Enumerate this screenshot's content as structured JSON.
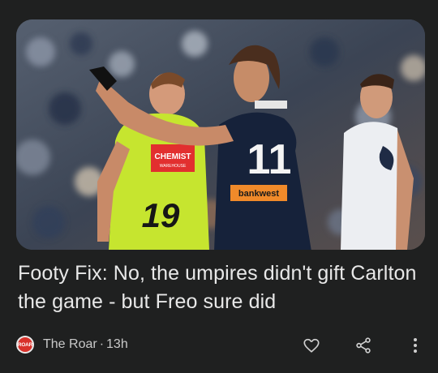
{
  "article": {
    "headline": "Footy Fix: No, the umpires didn't gift Carlton the game - but Freo sure did",
    "source": "The Roar",
    "separator": "·",
    "time": "13h",
    "source_logo_text": "ROAR"
  },
  "photo": {
    "umpire_sign": "CHEMIST",
    "umpire_sign_sub": "WAREHOUSE",
    "umpire_number": "19",
    "player_number": "11",
    "player_sponsor": "bankwest"
  },
  "icons": {
    "like": "heart-icon",
    "share": "share-icon",
    "more": "more-vert-icon"
  },
  "colors": {
    "card_bg": "#1f2020",
    "headline": "#e8e8e8",
    "meta": "#c9c9c9",
    "brand_red": "#d8322b",
    "umpire_green": "#c6e52f",
    "player_navy": "#16223a"
  }
}
